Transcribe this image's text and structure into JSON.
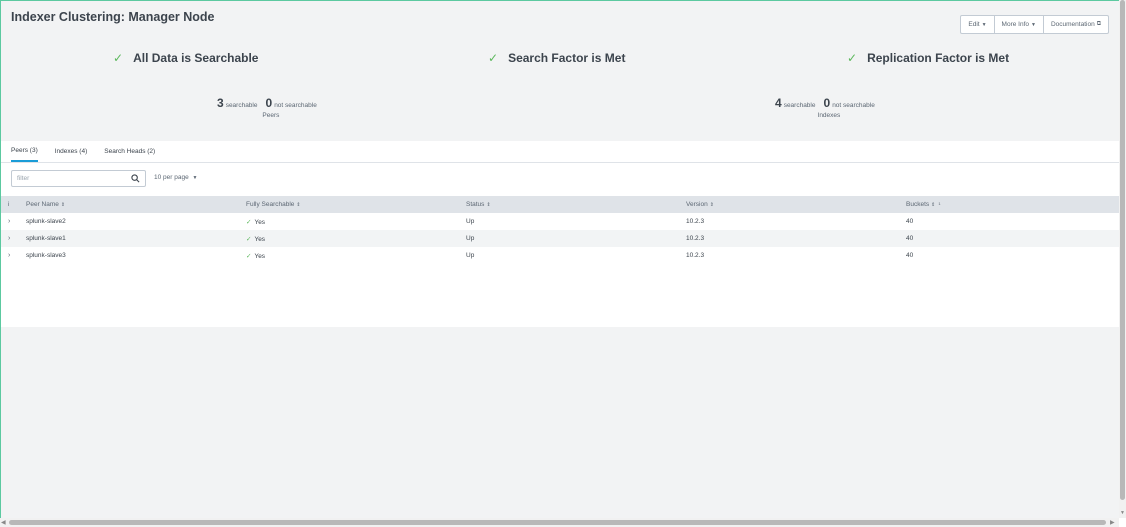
{
  "page": {
    "title": "Indexer Clustering: Manager Node",
    "actions": {
      "edit": "Edit",
      "more_info": "More Info",
      "documentation": "Documentation"
    }
  },
  "status": [
    {
      "label": "All Data is Searchable"
    },
    {
      "label": "Search Factor is Met"
    },
    {
      "label": "Replication Factor is Met"
    }
  ],
  "summaries": {
    "peers": {
      "searchable_count": "3",
      "searchable_label": "searchable",
      "not_searchable_count": "0",
      "not_searchable_label": "not searchable",
      "caption": "Peers"
    },
    "indexes": {
      "searchable_count": "4",
      "searchable_label": "searchable",
      "not_searchable_count": "0",
      "not_searchable_label": "not searchable",
      "caption": "Indexes"
    }
  },
  "tabs": [
    {
      "label": "Peers (3)",
      "active": true
    },
    {
      "label": "Indexes (4)",
      "active": false
    },
    {
      "label": "Search Heads (2)",
      "active": false
    }
  ],
  "filter": {
    "placeholder": "filter"
  },
  "per_page": "10 per page",
  "table": {
    "columns": [
      "i",
      "Peer Name",
      "Fully Searchable",
      "Status",
      "Version",
      "Buckets"
    ],
    "buckets_note": "1",
    "rows": [
      {
        "peer_name": "splunk-slave2",
        "fully_searchable": "Yes",
        "status": "Up",
        "version": "10.2.3",
        "buckets": "40"
      },
      {
        "peer_name": "splunk-slave1",
        "fully_searchable": "Yes",
        "status": "Up",
        "version": "10.2.3",
        "buckets": "40"
      },
      {
        "peer_name": "splunk-slave3",
        "fully_searchable": "Yes",
        "status": "Up",
        "version": "10.2.3",
        "buckets": "40"
      }
    ]
  },
  "colors": {
    "accent": "#1a9cd7",
    "success": "#5cb85c",
    "frame": "#5cc9a0"
  }
}
